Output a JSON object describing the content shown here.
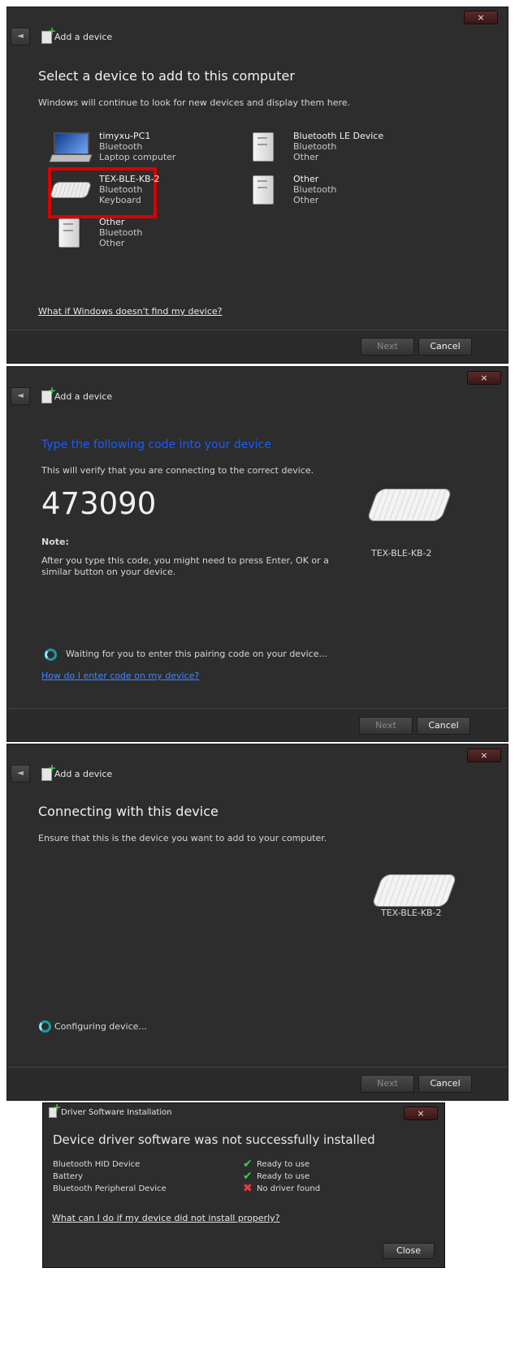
{
  "dialog1": {
    "window_close": "×",
    "back_label": "◄",
    "header": "Add a device",
    "title": "Select a device to add to this computer",
    "subtitle": "Windows will continue to look for new devices and display them here.",
    "devices": [
      {
        "name": "timyxu-PC1",
        "type": "Bluetooth",
        "category": "Laptop computer",
        "icon": "laptop-icon"
      },
      {
        "name": "Bluetooth LE Device",
        "type": "Bluetooth",
        "category": "Other",
        "icon": "device-tower-icon"
      },
      {
        "name": "TEX-BLE-KB-2",
        "type": "Bluetooth",
        "category": "Keyboard",
        "icon": "keyboard-icon"
      },
      {
        "name": "Other",
        "type": "Bluetooth",
        "category": "Other",
        "icon": "device-tower-icon"
      },
      {
        "name": "Other",
        "type": "Bluetooth",
        "category": "Other",
        "icon": "device-tower-icon"
      }
    ],
    "help_link": "What if Windows doesn't find my device?",
    "next": "Next",
    "cancel": "Cancel"
  },
  "dialog2": {
    "window_close": "×",
    "back_label": "◄",
    "header": "Add a device",
    "title": "Type the following code into your device",
    "subtitle": "This will verify that you are connecting to the correct device.",
    "code": "473090",
    "note_label": "Note:",
    "note_text": "After you type this code, you might need to press Enter, OK or a similar button on your device.",
    "device_name": "TEX-BLE-KB-2",
    "status": "Waiting for you to enter this pairing code on your device...",
    "help_link": "How do I enter code on my device?",
    "next": "Next",
    "cancel": "Cancel"
  },
  "dialog3": {
    "window_close": "×",
    "back_label": "◄",
    "header": "Add a device",
    "title": "Connecting with this device",
    "subtitle": "Ensure that this is the device you want to add to your computer.",
    "device_name": "TEX-BLE-KB-2",
    "status": "Configuring device...",
    "next": "Next",
    "cancel": "Cancel"
  },
  "driver": {
    "window_close": "×",
    "window_title": "Driver Software Installation",
    "heading": "Device driver software was not successfully installed",
    "rows": [
      {
        "name": "Bluetooth HID Device",
        "status": "Ready to use",
        "icon": "check-icon"
      },
      {
        "name": "Battery",
        "status": "Ready to use",
        "icon": "check-icon"
      },
      {
        "name": "Bluetooth Peripheral Device",
        "status": "No driver found",
        "icon": "error-icon"
      }
    ],
    "help_link": "What can I do if my device did not install properly?",
    "close": "Close"
  }
}
